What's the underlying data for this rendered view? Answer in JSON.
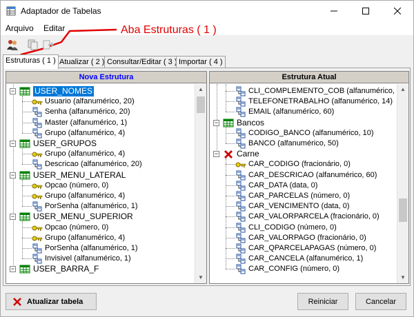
{
  "window": {
    "title": "Adaptador de Tabelas",
    "minimize_icon": "minimize-icon",
    "maximize_icon": "maximize-icon",
    "close_icon": "close-icon"
  },
  "menu": {
    "items": [
      "Arquivo",
      "Editar"
    ]
  },
  "annotation": {
    "text": "Aba Estruturas ( 1 )",
    "color": "#e00000"
  },
  "tabs": [
    {
      "label": "Estruturas ( 1 )",
      "active": true
    },
    {
      "label": "Atualizar ( 2 )"
    },
    {
      "label": "Consultar/Editar ( 3 )"
    },
    {
      "label": "Importar ( 4 )"
    }
  ],
  "left_panel": {
    "header": "Nova Estrutura",
    "rows": [
      {
        "type": "table",
        "text": "USER_NOMES",
        "selected": true
      },
      {
        "type": "key",
        "text": "Usuario (alfanumérico, 20)"
      },
      {
        "type": "field",
        "text": "Senha (alfanumérico, 20)"
      },
      {
        "type": "field",
        "text": "Master (alfanumérico, 1)"
      },
      {
        "type": "field",
        "text": "Grupo (alfanumérico, 4)"
      },
      {
        "type": "table",
        "text": "USER_GRUPOS"
      },
      {
        "type": "key",
        "text": "Grupo (alfanumérico, 4)"
      },
      {
        "type": "field",
        "text": "Descricao (alfanumérico, 20)"
      },
      {
        "type": "table",
        "text": "USER_MENU_LATERAL"
      },
      {
        "type": "key",
        "text": "Opcao (número, 0)"
      },
      {
        "type": "key",
        "text": "Grupo (alfanumérico, 4)"
      },
      {
        "type": "field",
        "text": "PorSenha (alfanumérico, 1)"
      },
      {
        "type": "table",
        "text": "USER_MENU_SUPERIOR"
      },
      {
        "type": "key",
        "text": "Opcao (número, 0)"
      },
      {
        "type": "key",
        "text": "Grupo (alfanumérico, 4)"
      },
      {
        "type": "field",
        "text": "PorSenha (alfanumérico, 1)"
      },
      {
        "type": "field",
        "text": "Invisivel (alfanumérico, 1)"
      },
      {
        "type": "table",
        "text": "USER_BARRA_F"
      }
    ]
  },
  "right_panel": {
    "header": "Estrutura Atual",
    "rows": [
      {
        "type": "field",
        "text": "CLI_COMPLEMENTO_COB (alfanumérico, 30)"
      },
      {
        "type": "field",
        "text": "TELEFONETRABALHO (alfanumérico, 14)"
      },
      {
        "type": "field",
        "text": "EMAIL (alfanumérico, 60)"
      },
      {
        "type": "table",
        "text": "Bancos"
      },
      {
        "type": "field",
        "text": "CODIGO_BANCO (alfanumérico, 10)"
      },
      {
        "type": "field",
        "text": "BANCO (alfanumérico, 50)"
      },
      {
        "type": "deleted",
        "text": "Carne"
      },
      {
        "type": "key",
        "text": "CAR_CODIGO (fracionário, 0)"
      },
      {
        "type": "field",
        "text": "CAR_DESCRICAO (alfanumérico, 60)"
      },
      {
        "type": "field",
        "text": "CAR_DATA (data, 0)"
      },
      {
        "type": "field",
        "text": "CAR_PARCELAS (número, 0)"
      },
      {
        "type": "field",
        "text": "CAR_VENCIMENTO (data, 0)"
      },
      {
        "type": "field",
        "text": "CAR_VALORPARCELA (fracionário, 0)"
      },
      {
        "type": "field",
        "text": "CLI_CODIGO (número, 0)"
      },
      {
        "type": "field",
        "text": "CAR_VALORPAGO (fracionário, 0)"
      },
      {
        "type": "field",
        "text": "CAR_QPARCELAPAGAS (número, 0)"
      },
      {
        "type": "field",
        "text": "CAR_CANCELA (alfanumérico, 1)"
      },
      {
        "type": "field",
        "text": "CAR_CONFIG (número, 0)"
      }
    ]
  },
  "buttons": {
    "update_table": "Atualizar tabela",
    "restart": "Reiniciar",
    "cancel": "Cancelar"
  },
  "colors": {
    "selection": "#0078d7",
    "table_icon_green": "#008000",
    "key_icon_yellow": "#c8b400",
    "deleted_red": "#cc0000",
    "header_bg": "#d4d0c8"
  }
}
